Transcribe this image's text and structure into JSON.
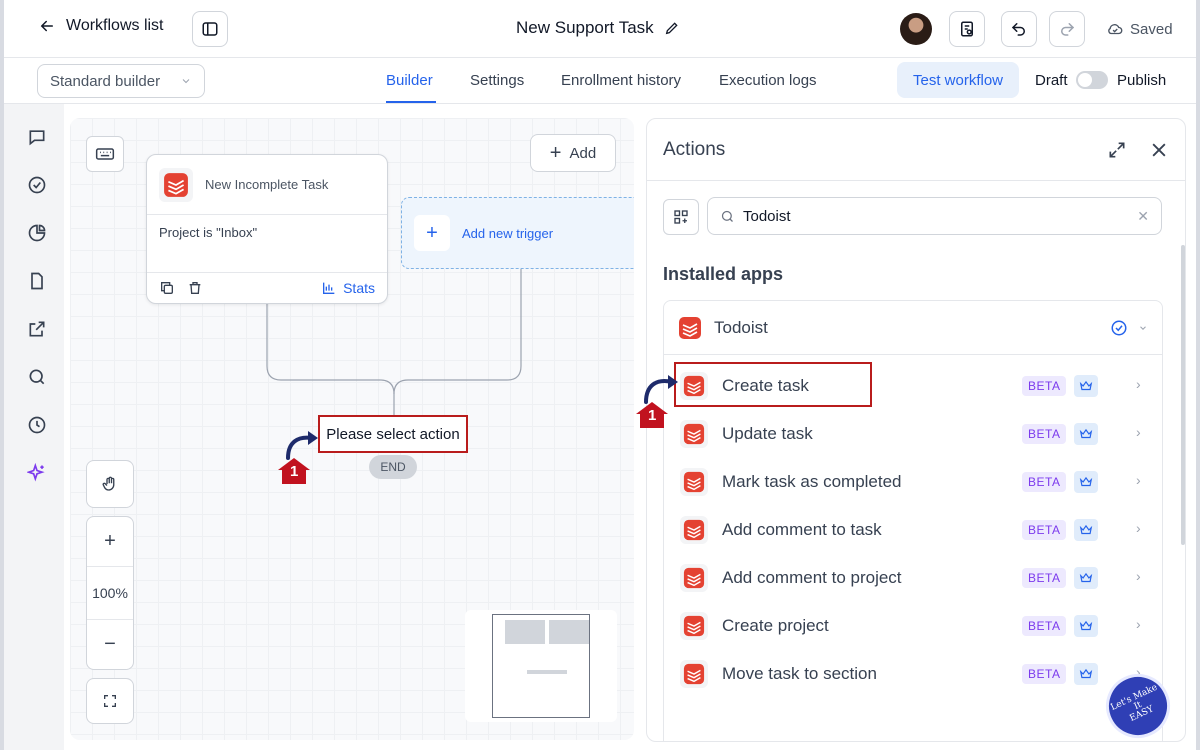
{
  "topbar": {
    "back_label": "Workflows list",
    "title": "New Support Task",
    "saved_label": "Saved"
  },
  "subbar": {
    "builder_select": "Standard builder",
    "tabs": [
      {
        "label": "Builder",
        "active": true
      },
      {
        "label": "Settings",
        "active": false
      },
      {
        "label": "Enrollment history",
        "active": false
      },
      {
        "label": "Execution logs",
        "active": false
      }
    ],
    "test_label": "Test workflow",
    "draft_label": "Draft",
    "publish_label": "Publish"
  },
  "canvas": {
    "add_label": "Add",
    "trigger": {
      "title": "New Incomplete Task",
      "condition": "Project is \"Inbox\"",
      "stats_label": "Stats"
    },
    "add_trigger_label": "Add new trigger",
    "select_action_label": "Please select action",
    "end_label": "END",
    "zoom_level": "100%",
    "step_marker": "1"
  },
  "panel": {
    "title": "Actions",
    "search_value": "Todoist",
    "installed_label": "Installed apps",
    "app_name": "Todoist",
    "beta_label": "BETA",
    "actions": [
      {
        "label": "Create task"
      },
      {
        "label": "Update task"
      },
      {
        "label": "Mark task as completed"
      },
      {
        "label": "Add comment to task"
      },
      {
        "label": "Add comment to project"
      },
      {
        "label": "Create project"
      },
      {
        "label": "Move task to section"
      }
    ],
    "step_marker": "1"
  },
  "watermark": {
    "line1": "Let's Make",
    "line2": "It",
    "line3": "EASY"
  },
  "colors": {
    "accent": "#2563eb",
    "highlight": "#b91c1c",
    "todoist": "#e44232",
    "beta": "#7c3aed"
  }
}
